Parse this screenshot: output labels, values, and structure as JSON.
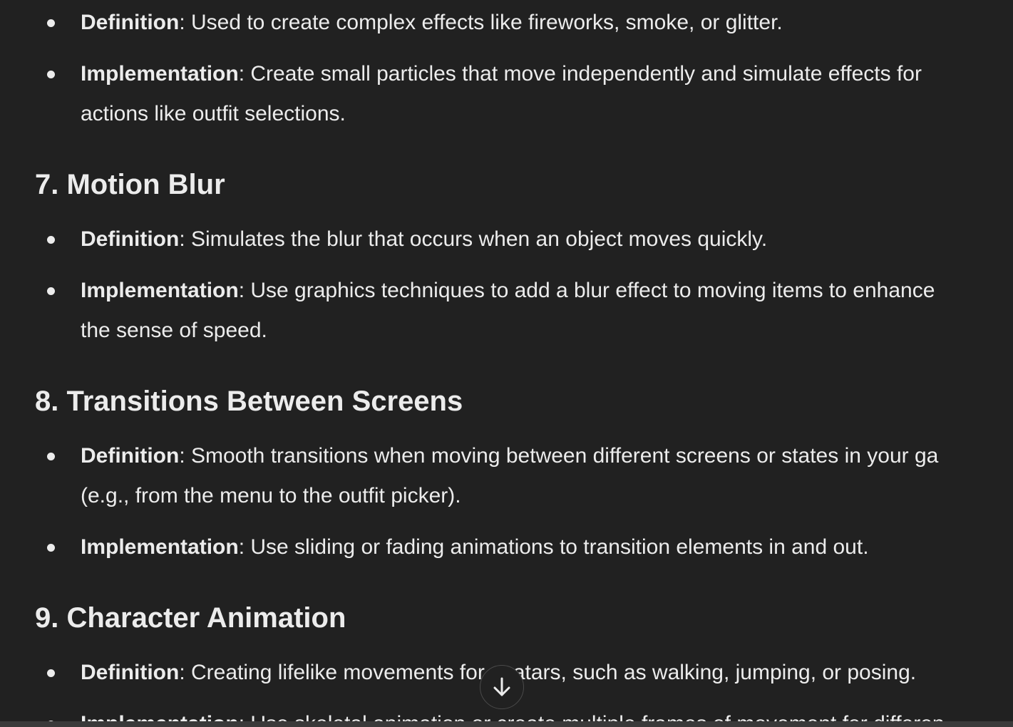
{
  "sections": {
    "s6": {
      "items": [
        {
          "term": "Definition",
          "text": ": Used to create complex effects like fireworks, smoke, or glitter."
        },
        {
          "term": "Implementation",
          "text": ": Create small particles that move independently and simulate effects for",
          "text2": "actions like outfit selections."
        }
      ]
    },
    "s7": {
      "heading": "7. Motion Blur",
      "items": [
        {
          "term": "Definition",
          "text": ": Simulates the blur that occurs when an object moves quickly."
        },
        {
          "term": "Implementation",
          "text": ": Use graphics techniques to add a blur effect to moving items to enhance",
          "text2": "the sense of speed."
        }
      ]
    },
    "s8": {
      "heading": "8. Transitions Between Screens",
      "items": [
        {
          "term": "Definition",
          "text": ": Smooth transitions when moving between different screens or states in your ga",
          "text2": "(e.g., from the menu to the outfit picker)."
        },
        {
          "term": "Implementation",
          "text": ": Use sliding or fading animations to transition elements in and out."
        }
      ]
    },
    "s9": {
      "heading": "9. Character Animation",
      "items": [
        {
          "term": "Definition",
          "text": ": Creating lifelike movements for avatars, such as walking, jumping, or posing."
        },
        {
          "term": "Implementation",
          "text": ": Use skeletal animation or create multiple frames of movement for differen"
        }
      ]
    }
  },
  "scroll_button": {
    "icon": "arrow-down-icon"
  }
}
